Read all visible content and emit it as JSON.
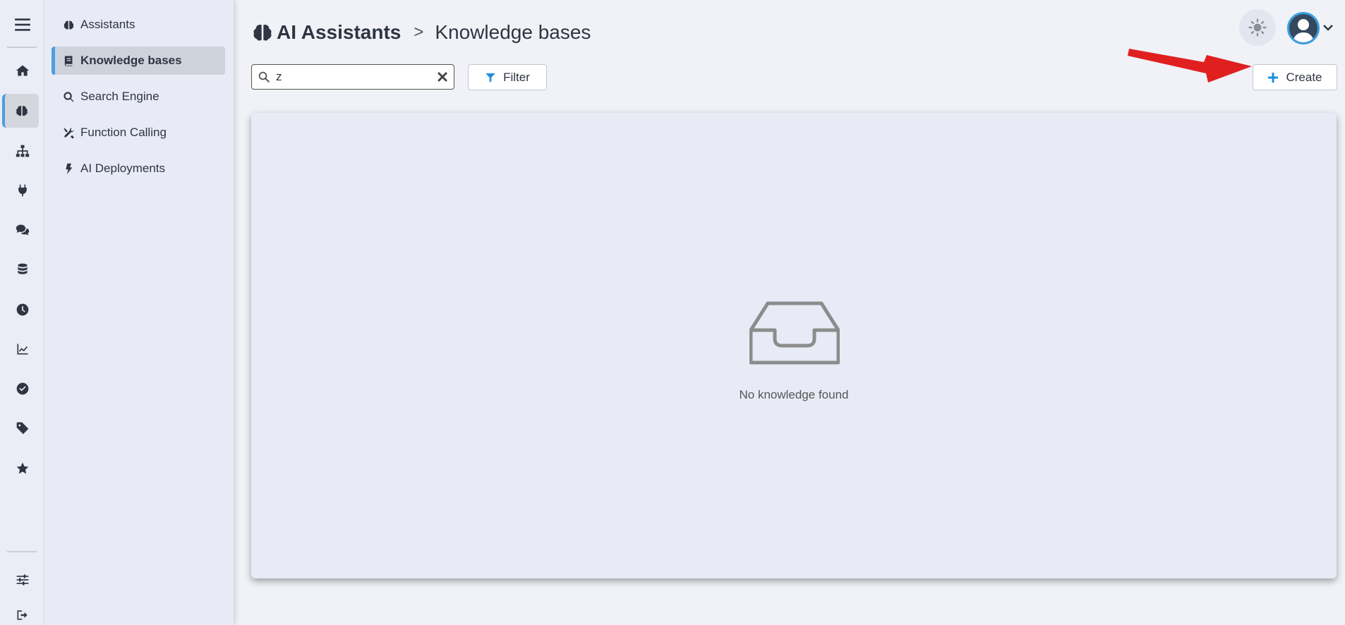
{
  "header": {
    "app_title": "AI Assistants",
    "separator": ">",
    "page_title": "Knowledge bases"
  },
  "sidebar": {
    "items": [
      {
        "label": "Assistants",
        "icon": "brain-icon",
        "active": false
      },
      {
        "label": "Knowledge bases",
        "icon": "book-icon",
        "active": true
      },
      {
        "label": "Search Engine",
        "icon": "search-icon",
        "active": false
      },
      {
        "label": "Function Calling",
        "icon": "tools-icon",
        "active": false
      },
      {
        "label": "AI Deployments",
        "icon": "bolt-icon",
        "active": false
      }
    ]
  },
  "rail": {
    "icons": [
      "menu-icon",
      "home-icon",
      "brain-icon",
      "sitemap-icon",
      "plug-icon",
      "comments-icon",
      "database-icon",
      "clock-icon",
      "chart-line-icon",
      "check-circle-icon",
      "tag-icon",
      "star-icon",
      "sliders-icon",
      "sign-out-icon"
    ],
    "active": "brain-icon"
  },
  "toolbar": {
    "search_value": "z",
    "filter_label": "Filter",
    "create_label": "Create"
  },
  "empty_state": {
    "icon": "inbox-icon",
    "message": "No knowledge found"
  },
  "colors": {
    "accent": "#4a9fe0",
    "filter_icon": "#1d8ee0",
    "create_icon": "#1d8ee0",
    "annotation_arrow": "#e0201f",
    "empty_icon": "#8c8c8c"
  }
}
